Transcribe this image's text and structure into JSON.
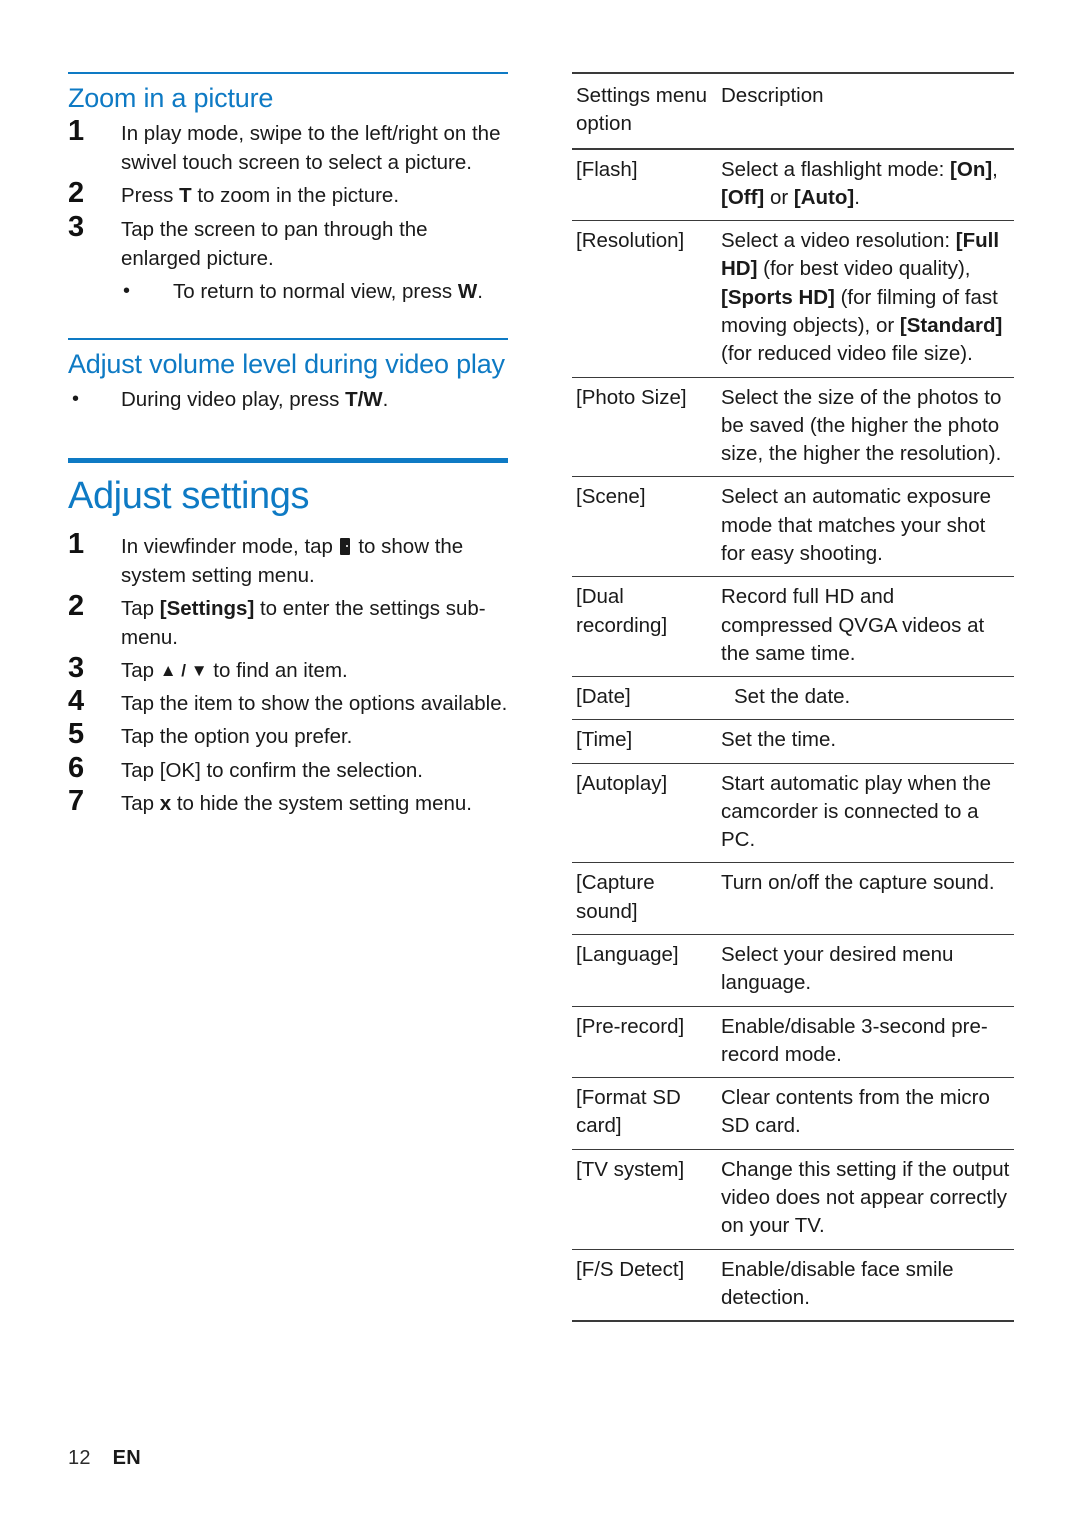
{
  "colors": {
    "heading_blue": "#0e7ac4",
    "body_text": "#1a1a1a",
    "rule_dark": "#3a3a3a"
  },
  "left_column": {
    "section1": {
      "heading": "Zoom in a picture",
      "steps": [
        {
          "num": "1",
          "text": "In play mode, swipe to the left/right on the swivel touch screen to select a picture."
        },
        {
          "num": "2",
          "text_before": "Press ",
          "emphasis": "T",
          "text_after": " to zoom in the picture."
        },
        {
          "num": "3",
          "text": "Tap the screen to pan through the enlarged picture."
        }
      ],
      "bullets": [
        {
          "text_before": "To return to normal view, press ",
          "emphasis": "W",
          "text_after": "."
        }
      ]
    },
    "section2": {
      "heading": "Adjust volume level during video play",
      "bullets": [
        {
          "text_before": "During video play, press ",
          "emphasis": "T/W",
          "text_after": "."
        }
      ]
    },
    "chapter": {
      "heading": "Adjust settings",
      "steps": [
        {
          "num": "1",
          "text_before": "In viewfinder mode, tap ",
          "icon": "menu-glyph-icon",
          "text_after": " to show the system setting menu."
        },
        {
          "num": "2",
          "text_before": "Tap ",
          "emphasis": "[Settings]",
          "text_after": " to enter the settings sub-menu."
        },
        {
          "num": "3",
          "text_before": "Tap ",
          "emphasis": "▲ / ▼",
          "text_after": " to find an item."
        },
        {
          "num": "4",
          "text": "Tap the item to show the options available."
        },
        {
          "num": "5",
          "text": "Tap the option you prefer."
        },
        {
          "num": "6",
          "text_before": "Tap ",
          "emphasis": "[OK]",
          "text_after": " to confirm the selection."
        },
        {
          "num": "7",
          "text_before": "Tap ",
          "emphasis": "x",
          "text_after": " to hide the system setting menu."
        }
      ]
    }
  },
  "settings_table": {
    "headers": [
      "Settings menu option",
      "Description"
    ],
    "rows": [
      {
        "option": "[Flash]",
        "description": "Select a flashlight mode: [On], [Off] or [Auto]."
      },
      {
        "option": "[Resolution]",
        "description": "Select a video resolution: [Full HD] (for best video quality), [Sports HD] (for filming of fast moving objects), or [Standard] (for reduced video file size)."
      },
      {
        "option": "[Photo Size]",
        "description": "Select the size of the photos to be saved (the higher the photo size, the higher the resolution)."
      },
      {
        "option": "[Scene]",
        "description": "Select an automatic exposure mode that matches your shot for easy shooting."
      },
      {
        "option": "[Dual recording]",
        "description": "Record full HD and compressed QVGA videos at the same time."
      },
      {
        "option": "[Date]",
        "description": "Set the date.",
        "indent": true
      },
      {
        "option": "[Time]",
        "description": "Set the time."
      },
      {
        "option": "[Autoplay]",
        "description": "Start automatic play when the camcorder is connected to a PC."
      },
      {
        "option": "[Capture sound]",
        "description": "Turn on/off the capture sound."
      },
      {
        "option": "[Language]",
        "description": "Select your desired menu language."
      },
      {
        "option": "[Pre-record]",
        "description": "Enable/disable 3-second pre-record mode."
      },
      {
        "option": "[Format SD card]",
        "description": "Clear contents from the micro SD card."
      },
      {
        "option": "[TV system]",
        "description": "Change this setting if the output video does not appear correctly on your TV."
      },
      {
        "option": "[F/S Detect]",
        "description": "Enable/disable face smile detection."
      }
    ]
  },
  "footer": {
    "page_number": "12",
    "language_code": "EN"
  }
}
